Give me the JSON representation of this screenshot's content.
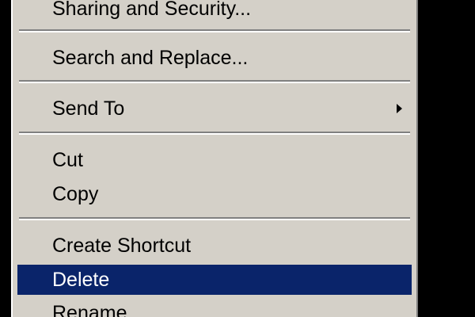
{
  "context_menu": {
    "items": [
      {
        "label": "Sharing and Security..."
      },
      {
        "label": "Search and Replace..."
      },
      {
        "label": "Send To",
        "has_submenu": true
      },
      {
        "label": "Cut"
      },
      {
        "label": "Copy"
      },
      {
        "label": "Create Shortcut"
      },
      {
        "label": "Delete",
        "highlighted": true
      },
      {
        "label": "Rename"
      }
    ],
    "icons": {
      "submenu": "chevron-right-icon"
    },
    "colors": {
      "menu_background": "#d4d0c8",
      "highlight_background": "#0a246a",
      "highlight_text": "#ffffff",
      "text": "#000000",
      "backdrop": "#000000"
    }
  }
}
